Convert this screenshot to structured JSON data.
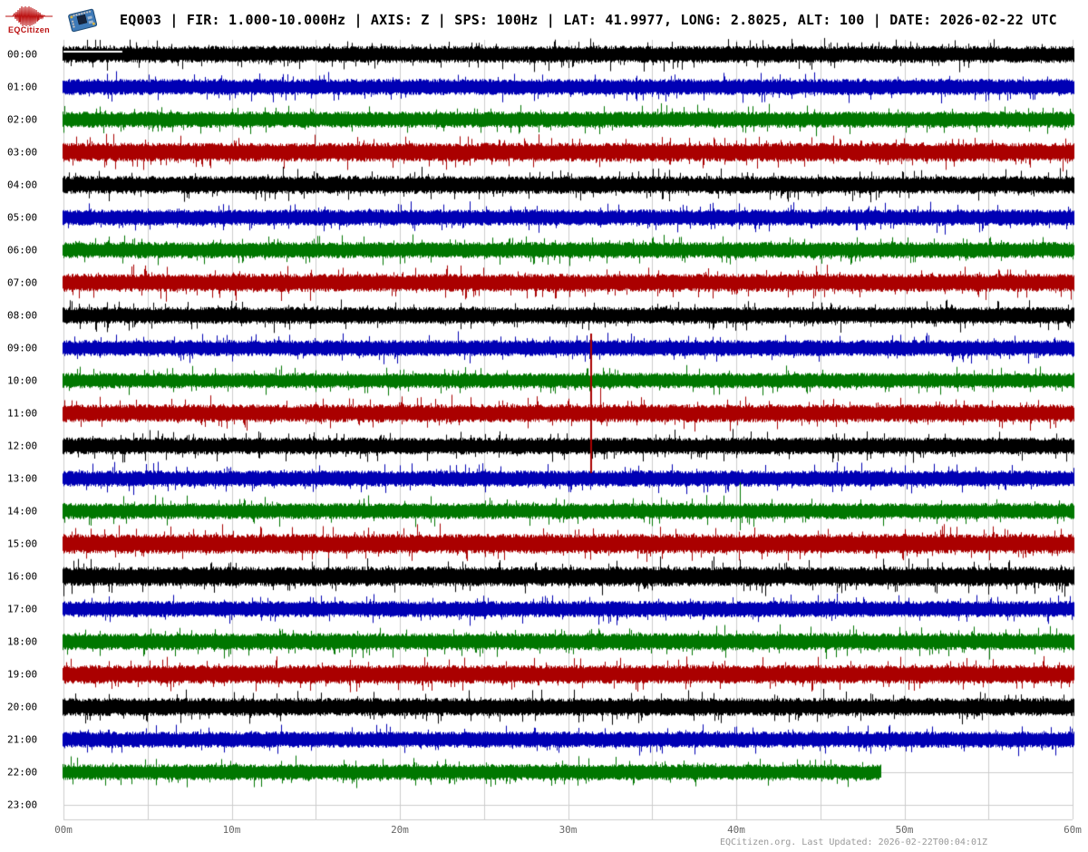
{
  "header": {
    "logo_text": "EQCitizen",
    "title": "EQ003 | FIR: 1.000-10.000Hz | AXIS: Z | SPS: 100Hz | LAT: 41.9977, LONG: 2.8025, ALT: 100 | DATE: 2026-02-22 UTC"
  },
  "footer": {
    "text": "EQCitizen.org. Last Updated: 2026-02-22T00:04:01Z"
  },
  "chart_data": {
    "type": "line",
    "subtype": "helicorder-seismogram",
    "title": "EQ003 24-hour helicorder, Z axis, 2026-02-22 UTC",
    "x_axis": {
      "unit": "minutes",
      "range": [
        0,
        60
      ],
      "tick_labels": [
        "00m",
        "10m",
        "20m",
        "30m",
        "40m",
        "50m",
        "60m"
      ],
      "gridline_interval_min": 5,
      "label_interval_min": 10
    },
    "y_axis": {
      "unit": "hour of day UTC",
      "rows_top_to_bottom": 24
    },
    "colors": {
      "trace_cycle": [
        "#000000",
        "#0000b4",
        "#007700",
        "#aa0000"
      ],
      "grid": "#cccccc",
      "gap_marker": "#ffffff",
      "axis_label": "#666666",
      "footer": "#999999"
    },
    "legend": "none",
    "grid": "on",
    "rows": [
      {
        "label": "00:00",
        "color": "#000000",
        "start_min": 0,
        "end_min": 60,
        "amp": 9.5,
        "gap_marker": {
          "start_min": 0,
          "end_min": 3.5
        }
      },
      {
        "label": "01:00",
        "color": "#0000b4",
        "start_min": 0,
        "end_min": 60,
        "amp": 9.0
      },
      {
        "label": "02:00",
        "color": "#007700",
        "start_min": 0,
        "end_min": 60,
        "amp": 9.0
      },
      {
        "label": "03:00",
        "color": "#aa0000",
        "start_min": 0,
        "end_min": 60,
        "amp": 10.5
      },
      {
        "label": "04:00",
        "color": "#000000",
        "start_min": 0,
        "end_min": 60,
        "amp": 10.0
      },
      {
        "label": "05:00",
        "color": "#0000b4",
        "start_min": 0,
        "end_min": 60,
        "amp": 9.0
      },
      {
        "label": "06:00",
        "color": "#007700",
        "start_min": 0,
        "end_min": 60,
        "amp": 9.0
      },
      {
        "label": "07:00",
        "color": "#aa0000",
        "start_min": 0,
        "end_min": 60,
        "amp": 10.0
      },
      {
        "label": "08:00",
        "color": "#000000",
        "start_min": 0,
        "end_min": 60,
        "amp": 9.5
      },
      {
        "label": "09:00",
        "color": "#0000b4",
        "start_min": 0,
        "end_min": 60,
        "amp": 9.0
      },
      {
        "label": "10:00",
        "color": "#007700",
        "start_min": 0,
        "end_min": 60,
        "amp": 8.5
      },
      {
        "label": "11:00",
        "color": "#aa0000",
        "start_min": 0,
        "end_min": 60,
        "amp": 10.0,
        "events": [
          {
            "min": 31.4,
            "up": 88,
            "down": 66,
            "width": 2
          },
          {
            "min": 31.9,
            "up": 28,
            "down": 10,
            "width": 1
          }
        ]
      },
      {
        "label": "12:00",
        "color": "#000000",
        "start_min": 0,
        "end_min": 60,
        "amp": 9.5
      },
      {
        "label": "13:00",
        "color": "#0000b4",
        "start_min": 0,
        "end_min": 60,
        "amp": 9.0
      },
      {
        "label": "14:00",
        "color": "#007700",
        "start_min": 0,
        "end_min": 60,
        "amp": 9.0,
        "events": [
          {
            "min": 40.2,
            "up": 32,
            "down": 21,
            "width": 1
          }
        ]
      },
      {
        "label": "15:00",
        "color": "#aa0000",
        "start_min": 0,
        "end_min": 60,
        "amp": 11.0
      },
      {
        "label": "16:00",
        "color": "#000000",
        "start_min": 0,
        "end_min": 60,
        "amp": 11.0
      },
      {
        "label": "17:00",
        "color": "#0000b4",
        "start_min": 0,
        "end_min": 60,
        "amp": 9.0
      },
      {
        "label": "18:00",
        "color": "#007700",
        "start_min": 0,
        "end_min": 60,
        "amp": 9.5
      },
      {
        "label": "19:00",
        "color": "#aa0000",
        "start_min": 0,
        "end_min": 60,
        "amp": 10.5
      },
      {
        "label": "20:00",
        "color": "#000000",
        "start_min": 0,
        "end_min": 60,
        "amp": 10.0
      },
      {
        "label": "21:00",
        "color": "#0000b4",
        "start_min": 0,
        "end_min": 60,
        "amp": 9.0
      },
      {
        "label": "22:00",
        "color": "#007700",
        "start_min": 0,
        "end_min": 48.5,
        "amp": 9.0
      },
      {
        "label": "23:00",
        "color": "#aa0000",
        "no_data": true
      }
    ]
  }
}
